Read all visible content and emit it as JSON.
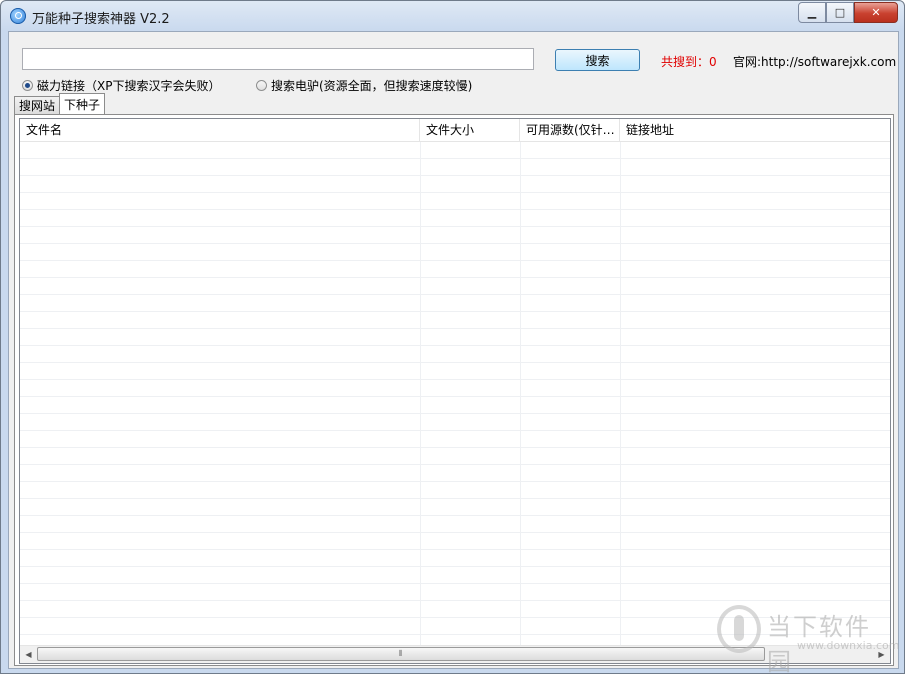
{
  "window": {
    "title": "万能种子搜索神器 V2.2",
    "minimize_glyph": "▁",
    "maximize_glyph": "□",
    "close_glyph": "✕"
  },
  "search": {
    "value": "",
    "placeholder": "",
    "button_label": "搜索",
    "result_count_label": "共搜到：0",
    "site_label": "官网:http://softwarejxk.com"
  },
  "options": {
    "magnet_label": "磁力链接（XP下搜索汉字会失败）",
    "magnet_checked": true,
    "ed2k_label": "搜索电驴(资源全面，但搜索速度较慢)",
    "ed2k_checked": false
  },
  "tabs": [
    {
      "label": "搜网站",
      "active": false
    },
    {
      "label": "下种子",
      "active": true
    }
  ],
  "table": {
    "columns": [
      "文件名",
      "文件大小",
      "可用源数(仅针…",
      "链接地址"
    ],
    "rows": []
  },
  "scrollbar": {
    "left_arrow": "◀",
    "right_arrow": "▶",
    "grip": "⦀"
  },
  "watermark": {
    "main": "当下软件园",
    "sub": "www.downxia.com"
  },
  "colors": {
    "count_label": "#e00000",
    "accent": "#3c7fb1"
  },
  "icons": {
    "app": "magnifier-icon"
  }
}
